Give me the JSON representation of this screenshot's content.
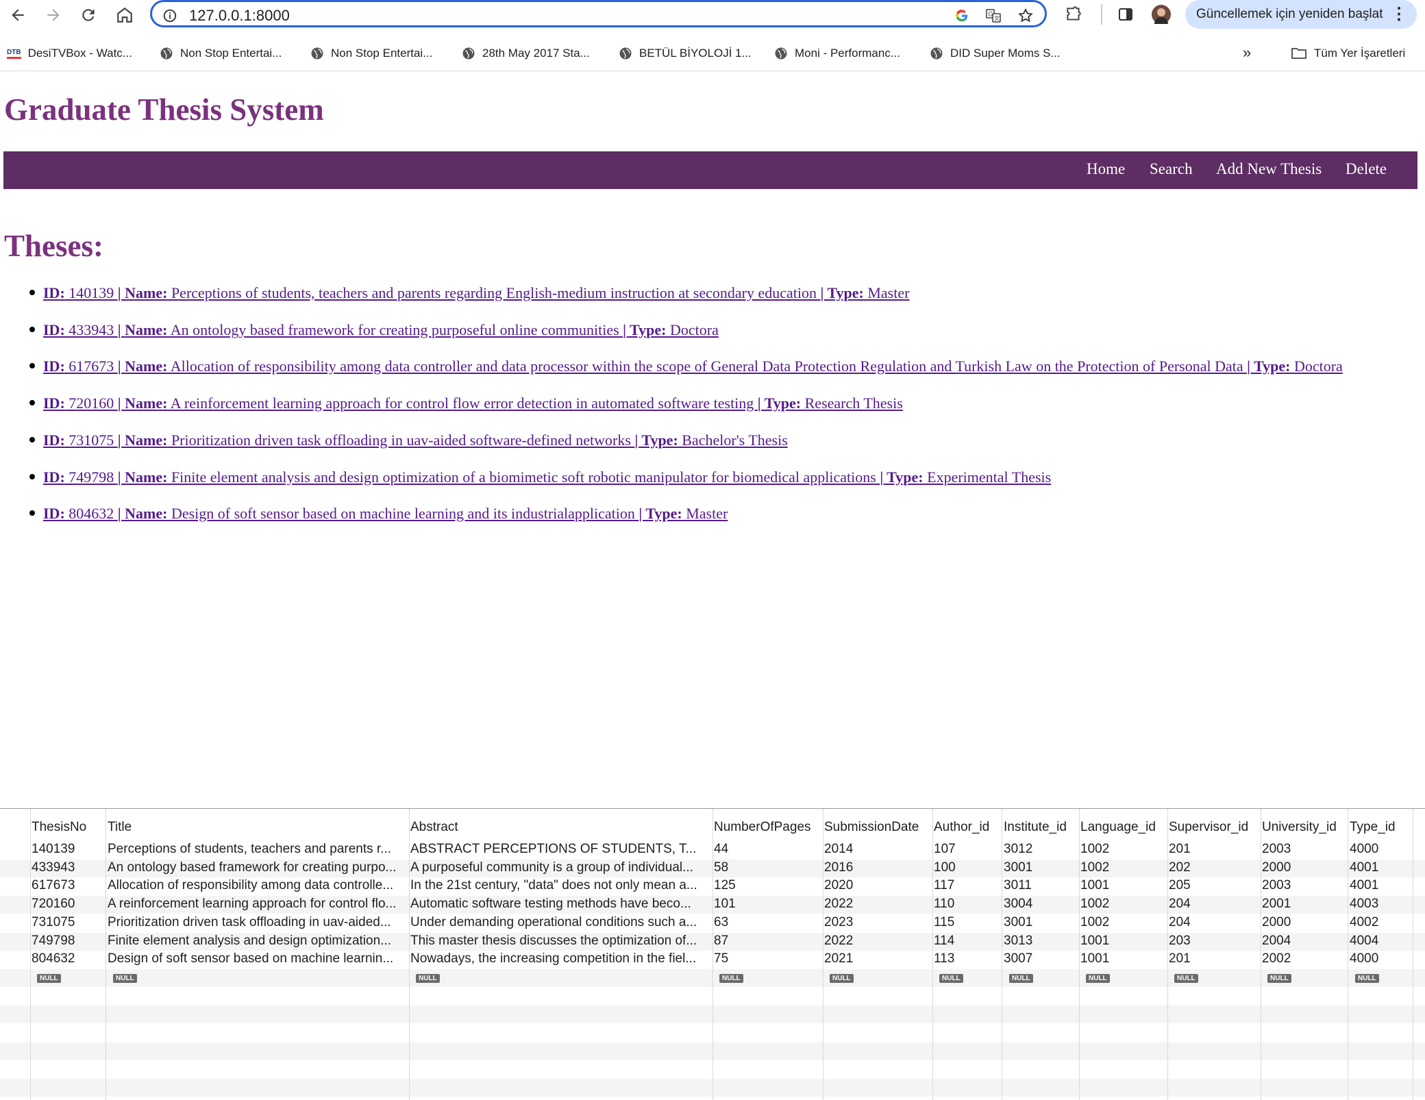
{
  "browser": {
    "url": "127.0.0.1:8000",
    "relaunch_label": "Güncellemek için yeniden başlat",
    "bookmarks": [
      "DesiTVBox - Watc...",
      "Non Stop Entertai...",
      "Non Stop Entertai...",
      "28th May 2017 Sta...",
      "BETÜL BİYOLOJİ 1...",
      "Moni - Performanc...",
      "DID Super Moms S..."
    ],
    "bookmark_badge": "DTB",
    "all_bookmarks_label": "Tüm Yer İşaretleri",
    "overflow_label": "»"
  },
  "site": {
    "title": "Graduate Thesis System",
    "nav": [
      "Home",
      "Search",
      "Add New Thesis",
      "Delete"
    ]
  },
  "theses": {
    "heading": "Theses:",
    "items": [
      {
        "id": "140139",
        "name": "Perceptions of students, teachers and parents regarding English-medium instruction at secondary education",
        "type": "Master"
      },
      {
        "id": "433943",
        "name": "An ontology based framework for creating purposeful online communities",
        "type": "Doctora"
      },
      {
        "id": "617673",
        "name": "Allocation of responsibility among data controller and data processor within the scope of General Data Protection Regulation and Turkish Law on the Protection of Personal Data",
        "type": "Doctora"
      },
      {
        "id": "720160",
        "name": "A reinforcement learning approach for control flow error detection in automated software testing",
        "type": "Research Thesis"
      },
      {
        "id": "731075",
        "name": "Prioritization driven task offloading in uav-aided software-defined networks",
        "type": "Bachelor's Thesis"
      },
      {
        "id": "749798",
        "name": "Finite element analysis and design optimization of a biomimetic soft robotic manipulator for biomedical applications",
        "type": "Experimental Thesis"
      },
      {
        "id": "804632",
        "name": "Design of soft sensor based on machine learning and its industrialapplication",
        "type": "Master"
      }
    ],
    "labels": {
      "id": "ID:",
      "name": "Name:",
      "type": "Type:",
      "sep": "|"
    }
  },
  "db_grid": {
    "columns": [
      "ThesisNo",
      "Title",
      "Abstract",
      "NumberOfPages",
      "SubmissionDate",
      "Author_id",
      "Institute_id",
      "Language_id",
      "Supervisor_id",
      "University_id",
      "Type_id"
    ],
    "rows": [
      [
        "140139",
        "Perceptions of students, teachers and parents r...",
        "ABSTRACT PERCEPTIONS OF STUDENTS, T...",
        "44",
        "2014",
        "107",
        "3012",
        "1002",
        "201",
        "2003",
        "4000"
      ],
      [
        "433943",
        "An ontology based framework for creating purpo...",
        "A purposeful community is a group of individual...",
        "58",
        "2016",
        "100",
        "3001",
        "1002",
        "202",
        "2000",
        "4001"
      ],
      [
        "617673",
        "Allocation of responsibility among data controlle...",
        "In the 21st century, \"data\" does not only mean a...",
        "125",
        "2020",
        "117",
        "3011",
        "1001",
        "205",
        "2003",
        "4001"
      ],
      [
        "720160",
        "A reinforcement learning approach for control flo...",
        "Automatic software testing methods have beco...",
        "101",
        "2022",
        "110",
        "3004",
        "1002",
        "204",
        "2001",
        "4003"
      ],
      [
        "731075",
        "Prioritization driven task offloading in uav-aided...",
        "Under demanding operational conditions such a...",
        "63",
        "2023",
        "115",
        "3001",
        "1002",
        "204",
        "2000",
        "4002"
      ],
      [
        "749798",
        "Finite element analysis and design optimization...",
        "This master thesis discusses the optimization of...",
        "87",
        "2022",
        "114",
        "3013",
        "1001",
        "203",
        "2004",
        "4004"
      ],
      [
        "804632",
        "Design of soft sensor based on machine learnin...",
        "Nowadays, the increasing competition in the fiel...",
        "75",
        "2021",
        "113",
        "3007",
        "1001",
        "201",
        "2002",
        "4000"
      ]
    ],
    "null_label": "NULL"
  },
  "icons": {
    "back": "arrow-left-icon",
    "forward": "arrow-right-icon",
    "reload": "reload-icon",
    "home": "home-icon",
    "site_info": "info-icon",
    "google": "google-icon",
    "translate": "translate-icon",
    "bookmark_star": "star-icon",
    "extensions": "puzzle-icon",
    "side_panel": "side-panel-icon",
    "profile": "avatar",
    "folder": "folder-icon"
  },
  "colors": {
    "accent": "#7b327d",
    "navbar": "#5d2d63",
    "link": "#551a8b",
    "omnibox_border": "#2a62d9",
    "relaunch_bg": "#d3e3fd"
  }
}
